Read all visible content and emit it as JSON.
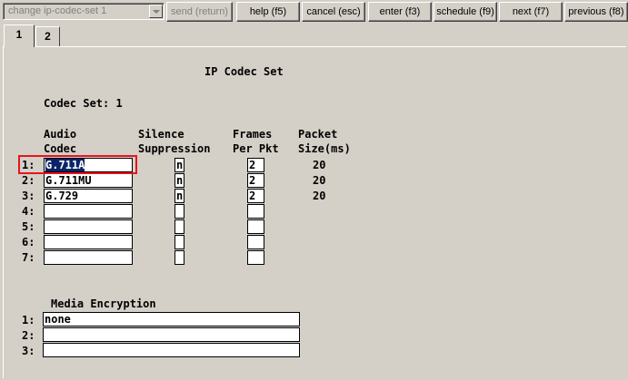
{
  "toolbar": {
    "command_text": "change ip-codec-set 1",
    "send_label": "send (return)",
    "help_label": "help (f5)",
    "cancel_label": "cancel (esc)",
    "enter_label": "enter (f3)",
    "schedule_label": "schedule (f9)",
    "next_label": "next (f7)",
    "previous_label": "previous (f8)"
  },
  "tabs": [
    "1",
    "2"
  ],
  "form": {
    "title": "IP Codec Set",
    "codec_set_label": "Codec Set: 1",
    "headers": {
      "audio_line1": "Audio",
      "audio_line2": "Codec",
      "silence_line1": "Silence",
      "silence_line2": "Suppression",
      "frames_line1": "Frames",
      "frames_line2": "Per Pkt",
      "packet_line1": "Packet",
      "packet_line2": "Size(ms)"
    },
    "rows": [
      {
        "num": "1:",
        "codec": "G.711A",
        "silence": "n",
        "frames": "2",
        "packet": "20"
      },
      {
        "num": "2:",
        "codec": "G.711MU",
        "silence": "n",
        "frames": "2",
        "packet": "20"
      },
      {
        "num": "3:",
        "codec": "G.729",
        "silence": "n",
        "frames": "2",
        "packet": "20"
      },
      {
        "num": "4:",
        "codec": "",
        "silence": "",
        "frames": "",
        "packet": ""
      },
      {
        "num": "5:",
        "codec": "",
        "silence": "",
        "frames": "",
        "packet": ""
      },
      {
        "num": "6:",
        "codec": "",
        "silence": "",
        "frames": "",
        "packet": ""
      },
      {
        "num": "7:",
        "codec": "",
        "silence": "",
        "frames": "",
        "packet": ""
      }
    ],
    "media_encryption": {
      "title": "Media Encryption",
      "rows": [
        {
          "num": "1:",
          "value": "none"
        },
        {
          "num": "2:",
          "value": ""
        },
        {
          "num": "3:",
          "value": ""
        }
      ]
    }
  },
  "colors": {
    "background": "#d4d0c8",
    "selection": "#0a246a",
    "highlight_box": "#e8141c"
  }
}
